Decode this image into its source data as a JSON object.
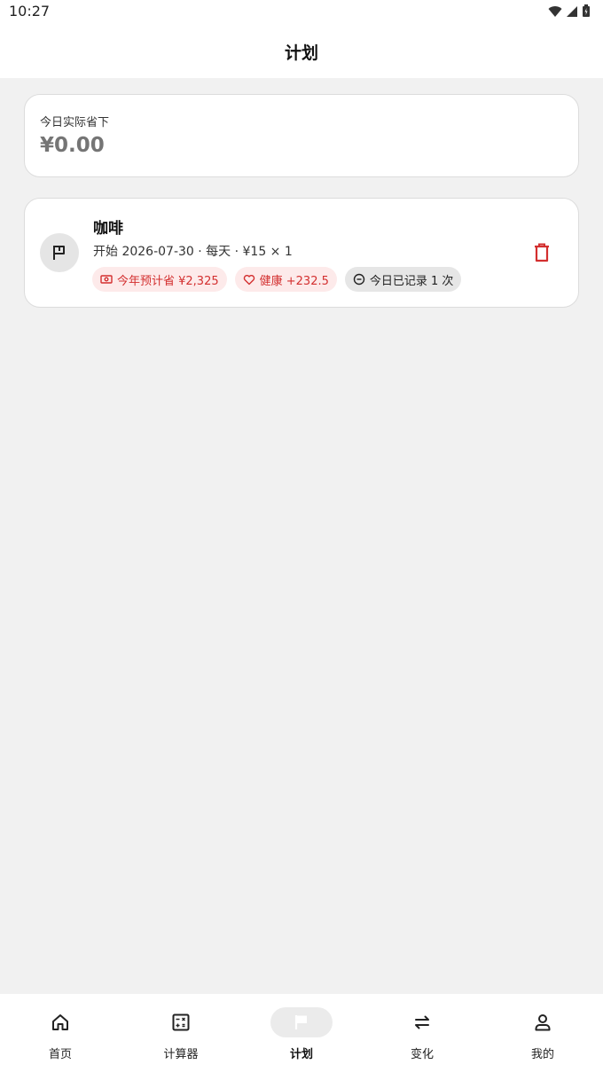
{
  "status_bar": {
    "time": "10:27"
  },
  "app_bar": {
    "title": "计划"
  },
  "summary": {
    "label": "今日实际省下",
    "value": "¥0.00"
  },
  "plans": [
    {
      "name": "咖啡",
      "meta": "开始 2026-07-30 · 每天 · ¥15 × 1",
      "chips": [
        {
          "icon": "money-icon",
          "text": "今年预计省 ¥2,325"
        },
        {
          "icon": "heart-icon",
          "text": "健康 +232.5"
        },
        {
          "icon": "minus-circle-icon",
          "text": "今日已记录 1 次"
        }
      ],
      "icon": "flag-icon",
      "delete_icon": "trash-icon"
    }
  ],
  "bottom_nav": {
    "active": "计划",
    "items": [
      {
        "label": "首页",
        "icon": "home-icon"
      },
      {
        "label": "计算器",
        "icon": "calculator-icon"
      },
      {
        "label": "计划",
        "icon": "flag-icon"
      },
      {
        "label": "变化",
        "icon": "swap-icon"
      },
      {
        "label": "我的",
        "icon": "person-icon"
      }
    ]
  },
  "colors": {
    "accent": "#d32f2f",
    "chip_red_bg": "#fdeaea",
    "chip_gray_bg": "#e6e6e6",
    "background": "#f1f1f1"
  }
}
